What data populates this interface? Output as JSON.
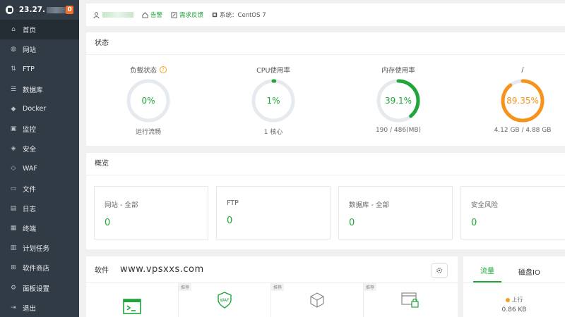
{
  "server": {
    "ip": "23.27.",
    "badge": "0"
  },
  "sidebar": {
    "items": [
      {
        "key": "home",
        "label": "首页",
        "icon": "home-icon",
        "glyph": "⌂"
      },
      {
        "key": "site",
        "label": "网站",
        "icon": "globe-icon",
        "glyph": "◍"
      },
      {
        "key": "ftp",
        "label": "FTP",
        "icon": "ftp-icon",
        "glyph": "⇅"
      },
      {
        "key": "db",
        "label": "数据库",
        "icon": "database-icon",
        "glyph": "☰"
      },
      {
        "key": "docker",
        "label": "Docker",
        "icon": "docker-icon",
        "glyph": "◆"
      },
      {
        "key": "monitor",
        "label": "监控",
        "icon": "monitor-icon",
        "glyph": "▣"
      },
      {
        "key": "security",
        "label": "安全",
        "icon": "shield-icon",
        "glyph": "◈"
      },
      {
        "key": "waf",
        "label": "WAF",
        "icon": "waf-shield-icon",
        "glyph": "◇"
      },
      {
        "key": "files",
        "label": "文件",
        "icon": "folder-icon",
        "glyph": "▭"
      },
      {
        "key": "logs",
        "label": "日志",
        "icon": "log-icon",
        "glyph": "▤"
      },
      {
        "key": "terminal",
        "label": "终端",
        "icon": "terminal-icon",
        "glyph": "▦"
      },
      {
        "key": "cron",
        "label": "计划任务",
        "icon": "calendar-icon",
        "glyph": "▥"
      },
      {
        "key": "store",
        "label": "软件商店",
        "icon": "grid-icon",
        "glyph": "⊞"
      },
      {
        "key": "settings",
        "label": "面板设置",
        "icon": "settings-icon",
        "glyph": "⚙"
      },
      {
        "key": "logout",
        "label": "退出",
        "icon": "logout-icon",
        "glyph": "⇥"
      }
    ]
  },
  "topbar": {
    "alerts": "告警",
    "feedback": "需求反馈",
    "system": "系统：CentOS 7"
  },
  "status": {
    "title": "状态",
    "load": {
      "label": "负载状态",
      "value": "0%",
      "sub": "运行流畅",
      "fraction": 0.0,
      "color": "#20a53a"
    },
    "cpu": {
      "label": "CPU使用率",
      "value": "1%",
      "sub": "1 核心",
      "fraction": 0.01,
      "color": "#20a53a"
    },
    "mem": {
      "label": "内存使用率",
      "value": "39.1%",
      "sub": "190 / 486(MB)",
      "fraction": 0.391,
      "color": "#20a53a"
    },
    "disk": {
      "label": "/",
      "value": "89.35%",
      "sub": "4.12 GB / 4.88 GB",
      "fraction": 0.8935,
      "color": "#f7931a"
    }
  },
  "overview": {
    "title": "概览",
    "cards": [
      {
        "label": "网站 - 全部",
        "value": "0"
      },
      {
        "label": "FTP",
        "value": "0"
      },
      {
        "label": "数据库 - 全部",
        "value": "0"
      },
      {
        "label": "安全风险",
        "value": "0"
      }
    ]
  },
  "software": {
    "title": "软件",
    "watermark": "www.vpsxxs.com",
    "tag": "推荐"
  },
  "traffic": {
    "tab_traffic": "流量",
    "tab_diskio": "磁盘IO",
    "upload_label": "上行",
    "upload_value": "0.86 KB"
  },
  "colors": {
    "accent": "#20a53a",
    "warning": "#f7931a",
    "sidebar": "#313b46"
  }
}
